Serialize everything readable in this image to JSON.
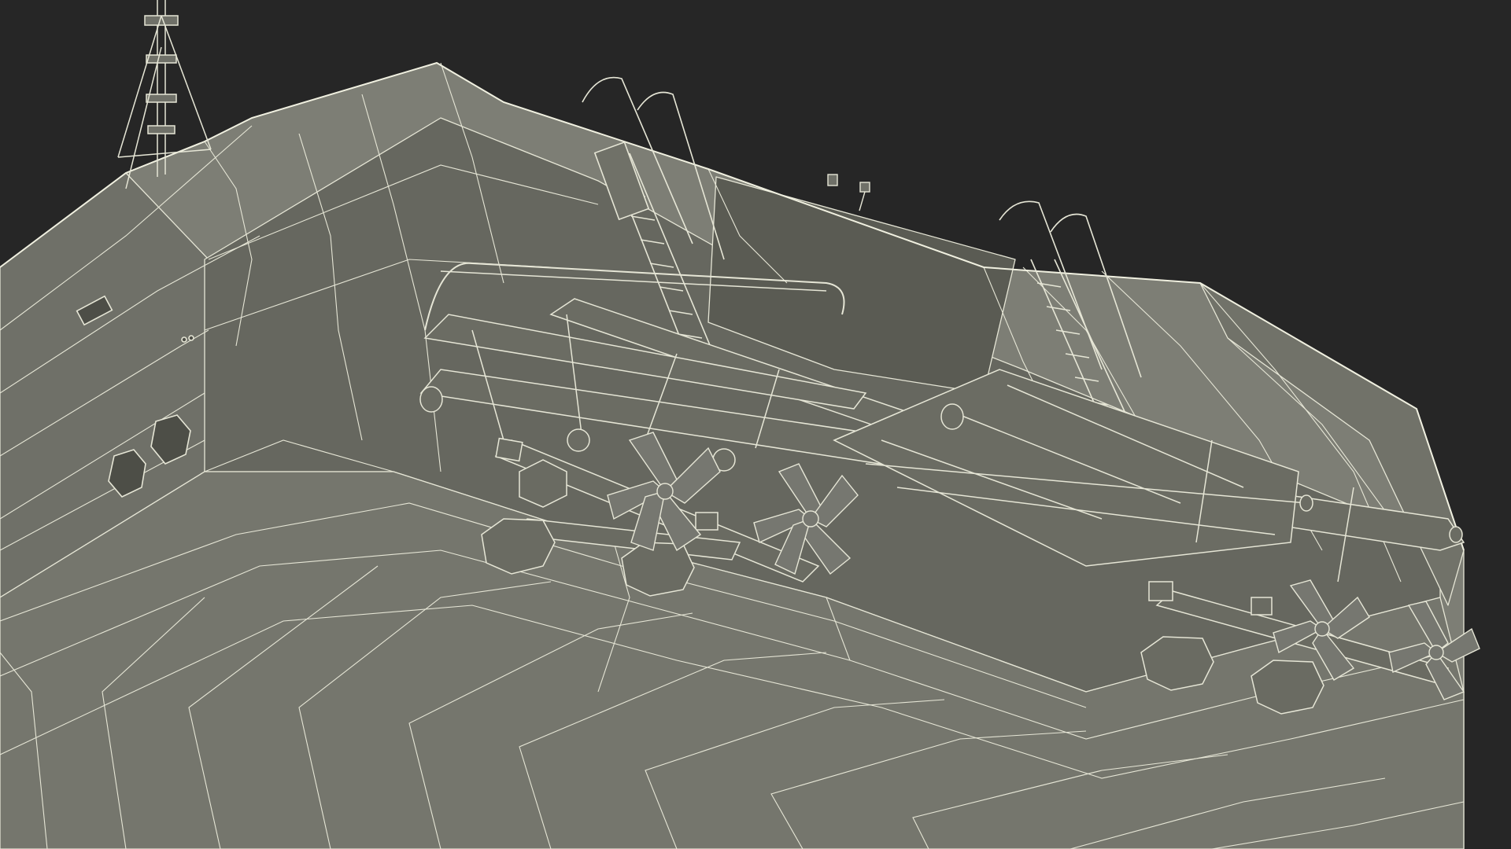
{
  "scene": {
    "subject": "wireframe-render",
    "colors": {
      "background": "#262626",
      "hull_fill": "#7a7b72",
      "hull_shadow": "#64655d",
      "hull_dark": "#55564f",
      "wire": "#e6e6d6",
      "wire_dim": "#c9c9ba"
    }
  }
}
